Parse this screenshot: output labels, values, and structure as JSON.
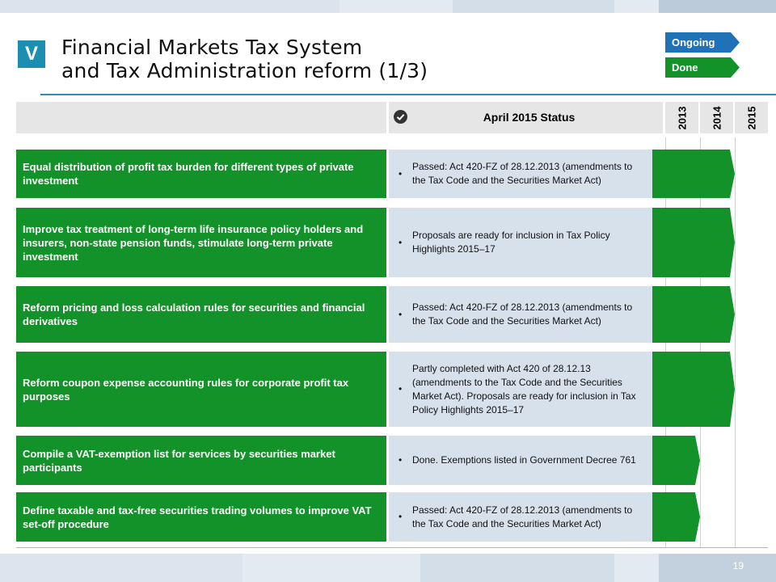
{
  "header": {
    "section_letter": "V",
    "title_line1": "Financial Markets Tax System",
    "title_line2": "and Tax Administration reform (1/3)"
  },
  "legend": {
    "ongoing": {
      "label": "Ongoing",
      "color": "#1f72b8"
    },
    "done": {
      "label": "Done",
      "color": "#139229"
    }
  },
  "table": {
    "status_header": "April 2015 Status",
    "status_icon": "check-circle-icon",
    "years": [
      "2013",
      "2014",
      "2015"
    ],
    "rows": [
      {
        "measure": "Equal distribution of profit tax burden for different types of private investment",
        "status": "Passed: Act 420-FZ of 28.12.2013 (amendments to the Tax Code and the Securities Market Act)",
        "state": "done",
        "end_year": "2014"
      },
      {
        "measure": "Improve tax treatment of long-term life insurance policy holders and insurers, non-state pension funds, stimulate long-term private investment",
        "status": "Proposals are ready for inclusion in Tax Policy Highlights 2015–17",
        "state": "done",
        "end_year": "2014"
      },
      {
        "measure": "Reform pricing and loss calculation rules for securities and financial derivatives",
        "status": "Passed: Act 420-FZ of 28.12.2013 (amendments to the Tax Code and the Securities Market Act)",
        "state": "done",
        "end_year": "2014"
      },
      {
        "measure": "Reform coupon expense accounting rules for corporate profit tax purposes",
        "status": "Partly completed with Act 420 of 28.12.13 (amendments to the Tax Code and the Securities Market Act). Proposals are ready for inclusion in Tax Policy Highlights 2015–17",
        "state": "done",
        "end_year": "2014"
      },
      {
        "measure": "Compile a VAT-exemption list for services by securities market participants",
        "status": "Done. Exemptions listed in Government Decree 761",
        "state": "done",
        "end_year": "2013"
      },
      {
        "measure": "Define taxable and tax-free securities trading volumes to improve VAT set-off procedure",
        "status": "Passed: Act 420-FZ of 28.12.2013 (amendments to the Tax Code and the Securities Market Act)",
        "state": "done",
        "end_year": "2013"
      }
    ]
  },
  "footer": {
    "page_number": "19"
  }
}
